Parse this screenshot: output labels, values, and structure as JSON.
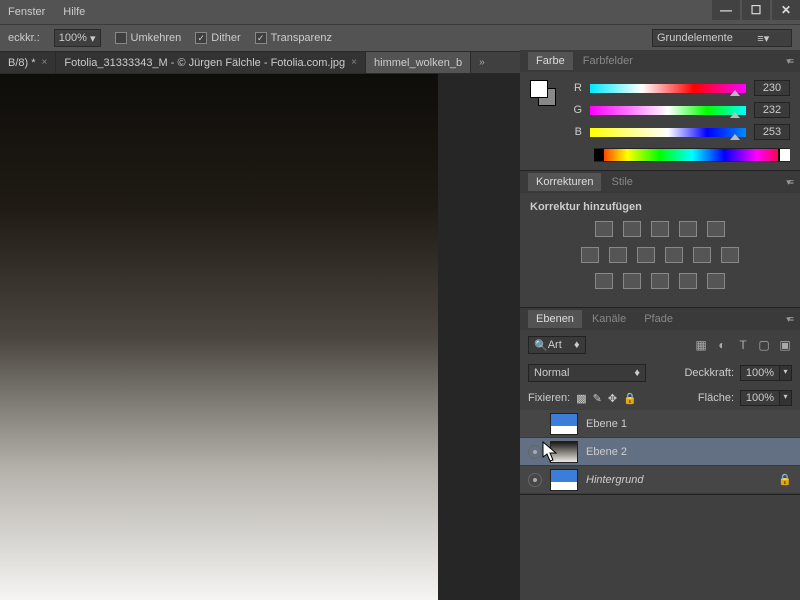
{
  "menu": {
    "fenster": "Fenster",
    "hilfe": "Hilfe"
  },
  "options": {
    "deckkr_label": "eckkr.:",
    "deckkr_value": "100%",
    "umkehren": "Umkehren",
    "dither": "Dither",
    "transparenz": "Transparenz",
    "workspace_combo": "Grundelemente"
  },
  "doc_tabs": {
    "t1": "B/8) *",
    "t2": "Fotolia_31333343_M - © Jürgen Fälchle - Fotolia.com.jpg",
    "t3": "himmel_wolken_b"
  },
  "color": {
    "tab1": "Farbe",
    "tab2": "Farbfelder",
    "r_label": "R",
    "r_val": "230",
    "g_label": "G",
    "g_val": "232",
    "b_label": "B",
    "b_val": "253"
  },
  "adjust": {
    "tab1": "Korrekturen",
    "tab2": "Stile",
    "title": "Korrektur hinzufügen"
  },
  "layers": {
    "tab1": "Ebenen",
    "tab2": "Kanäle",
    "tab3": "Pfade",
    "kind_combo": "Art",
    "blend": "Normal",
    "deckkraft_label": "Deckkraft:",
    "deckkraft_val": "100%",
    "fixieren_label": "Fixieren:",
    "flaeche_label": "Fläche:",
    "flaeche_val": "100%",
    "l1": "Ebene 1",
    "l2": "Ebene 2",
    "l3": "Hintergrund"
  }
}
